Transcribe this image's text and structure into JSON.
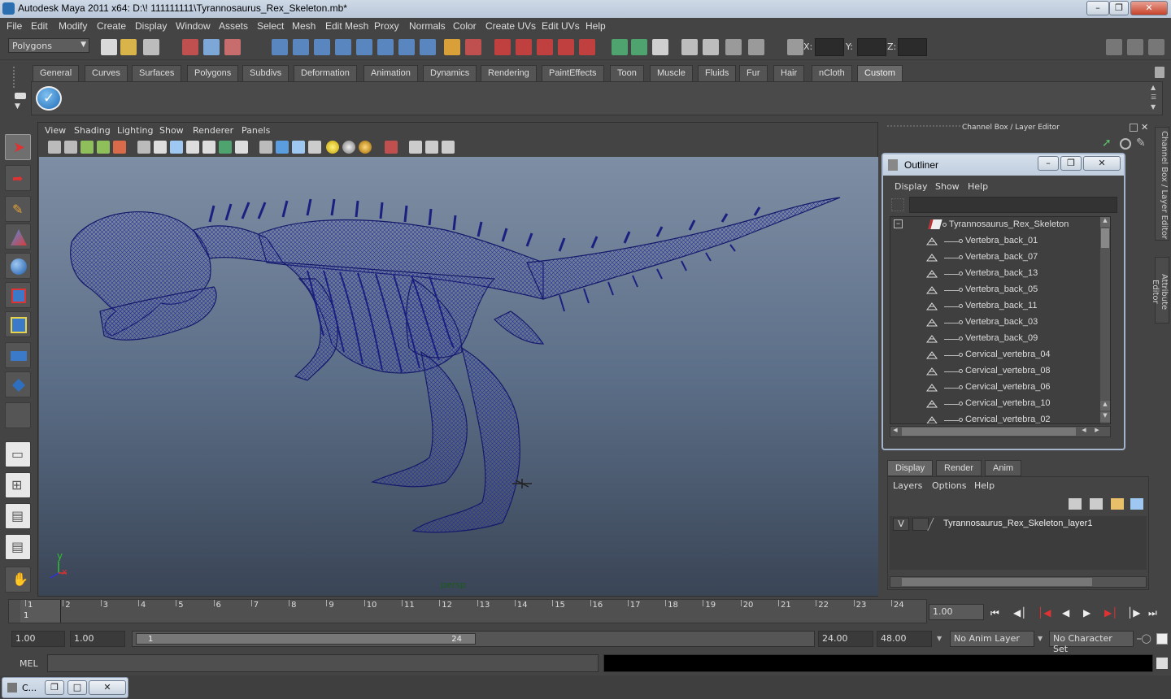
{
  "window": {
    "title": "Autodesk Maya 2011 x64: D:\\! 111111111\\Tyrannosaurus_Rex_Skeleton.mb*"
  },
  "menubar": [
    "File",
    "Edit",
    "Modify",
    "Create",
    "Display",
    "Window",
    "Assets",
    "Select",
    "Mesh",
    "Edit Mesh",
    "Proxy",
    "Normals",
    "Color",
    "Create UVs",
    "Edit UVs",
    "Help"
  ],
  "statusline": {
    "mode": "Polygons",
    "x_label": "X:",
    "y_label": "Y:",
    "z_label": "Z:"
  },
  "shelf": {
    "tabs": [
      "General",
      "Curves",
      "Surfaces",
      "Polygons",
      "Subdivs",
      "Deformation",
      "Animation",
      "Dynamics",
      "Rendering",
      "PaintEffects",
      "Toon",
      "Muscle",
      "Fluids",
      "Fur",
      "Hair",
      "nCloth",
      "Custom"
    ],
    "active": "Custom"
  },
  "viewport": {
    "menus": [
      "View",
      "Shading",
      "Lighting",
      "Show",
      "Renderer",
      "Panels"
    ],
    "camera": "persp",
    "axis_y": "y",
    "axis_x": "x"
  },
  "rightpanel": {
    "header": "Channel Box / Layer Editor",
    "vtab_channel": "Channel Box / Layer Editor",
    "vtab_attr": "Attribute Editor"
  },
  "outliner": {
    "title": "Outliner",
    "menus": [
      "Display",
      "Show",
      "Help"
    ],
    "root": "Tyrannosaurus_Rex_Skeleton",
    "items": [
      "Vertebra_back_01",
      "Vertebra_back_07",
      "Vertebra_back_13",
      "Vertebra_back_05",
      "Vertebra_back_11",
      "Vertebra_back_03",
      "Vertebra_back_09",
      "Cervical_vertebra_04",
      "Cervical_vertebra_08",
      "Cervical_vertebra_06",
      "Cervical_vertebra_10",
      "Cervical_vertebra_02"
    ]
  },
  "layereditor": {
    "tabs": [
      "Display",
      "Render",
      "Anim"
    ],
    "menus": [
      "Layers",
      "Options",
      "Help"
    ],
    "layer_visibility": "V",
    "layer_name": "Tyrannosaurus_Rex_Skeleton_layer1"
  },
  "timeline": {
    "ticks": [
      "1",
      "2",
      "3",
      "4",
      "5",
      "6",
      "7",
      "8",
      "9",
      "10",
      "11",
      "12",
      "13",
      "14",
      "15",
      "16",
      "17",
      "18",
      "19",
      "20",
      "21",
      "22",
      "23",
      "24"
    ],
    "current_frame_label": "1",
    "current_time": "1.00"
  },
  "rangebar": {
    "start_time": "1.00",
    "playback_start": "1.00",
    "range_start": "1",
    "range_end": "24",
    "playback_end": "24.00",
    "end_time": "48.00",
    "anim_layer": "No Anim Layer",
    "character_set": "No Character Set"
  },
  "commandline": {
    "label": "MEL"
  },
  "taskbar": {
    "minimized_label": "C..."
  }
}
